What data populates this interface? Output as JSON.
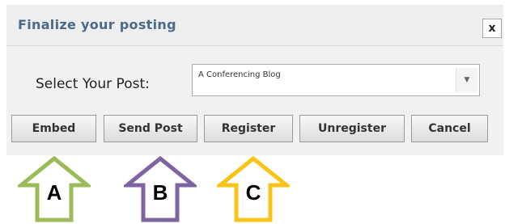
{
  "dialog": {
    "title": "Finalize your posting",
    "close_label": "x",
    "select_label": "Select Your Post:",
    "select_value": "A Conferencing Blog",
    "select_arrow": "▼"
  },
  "buttons": {
    "embed": "Embed",
    "send_post": "Send Post",
    "register": "Register",
    "unregister": "Unregister",
    "cancel": "Cancel"
  },
  "annotations": [
    {
      "letter": "A",
      "color": "#9bbb59"
    },
    {
      "letter": "B",
      "color": "#8064a2"
    },
    {
      "letter": "C",
      "color": "#f9c418"
    }
  ]
}
